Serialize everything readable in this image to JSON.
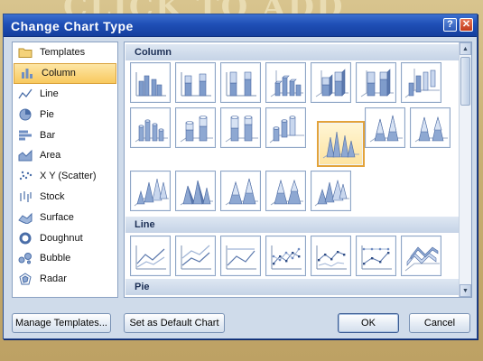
{
  "background_text": "CLICK TO ADD",
  "dialog": {
    "title": "Change Chart Type",
    "help_glyph": "?",
    "close_glyph": "✕"
  },
  "chart_types": [
    {
      "label": "Templates",
      "icon": "folder-icon",
      "selected": false
    },
    {
      "label": "Column",
      "icon": "column-chart-icon",
      "selected": true
    },
    {
      "label": "Line",
      "icon": "line-chart-icon",
      "selected": false
    },
    {
      "label": "Pie",
      "icon": "pie-chart-icon",
      "selected": false
    },
    {
      "label": "Bar",
      "icon": "bar-chart-icon",
      "selected": false
    },
    {
      "label": "Area",
      "icon": "area-chart-icon",
      "selected": false
    },
    {
      "label": "X Y (Scatter)",
      "icon": "scatter-chart-icon",
      "selected": false
    },
    {
      "label": "Stock",
      "icon": "stock-chart-icon",
      "selected": false
    },
    {
      "label": "Surface",
      "icon": "surface-chart-icon",
      "selected": false
    },
    {
      "label": "Doughnut",
      "icon": "doughnut-chart-icon",
      "selected": false
    },
    {
      "label": "Bubble",
      "icon": "bubble-chart-icon",
      "selected": false
    },
    {
      "label": "Radar",
      "icon": "radar-chart-icon",
      "selected": false
    }
  ],
  "sections": {
    "column": "Column",
    "line": "Line",
    "pie": "Pie"
  },
  "selected_subtype": "3d-cone",
  "buttons": {
    "manage_templates": "Manage Templates...",
    "set_default": "Set as Default Chart",
    "ok": "OK",
    "cancel": "Cancel"
  },
  "colors": {
    "title_bar": "#1f4fb6",
    "selection_fill": "#f8c95e",
    "thumb_blue": "#6f8fc3"
  }
}
